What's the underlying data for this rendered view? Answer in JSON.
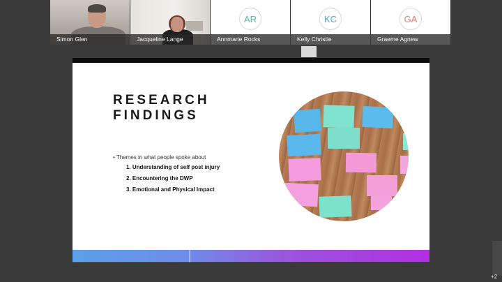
{
  "participants": [
    {
      "name": "Simon Glen"
    },
    {
      "name": "Jacqueline Lange"
    },
    {
      "name": "Annmarie Rocks",
      "initials": "AR",
      "color": "#5fb39c"
    },
    {
      "name": "Kelly Christie",
      "initials": "KC",
      "color": "#4aa8c4"
    },
    {
      "name": "Graeme Agnew",
      "initials": "GA",
      "color": "#e07a6a"
    }
  ],
  "slide": {
    "title_line1": "RESEARCH",
    "title_line2": "FINDINGS",
    "bullet": "• Themes in what people spoke about",
    "items": [
      "1. Understanding of self post injury",
      "2. Encountering the DWP",
      "3. Emotional and Physical Impact"
    ]
  },
  "more_participants": "+2"
}
